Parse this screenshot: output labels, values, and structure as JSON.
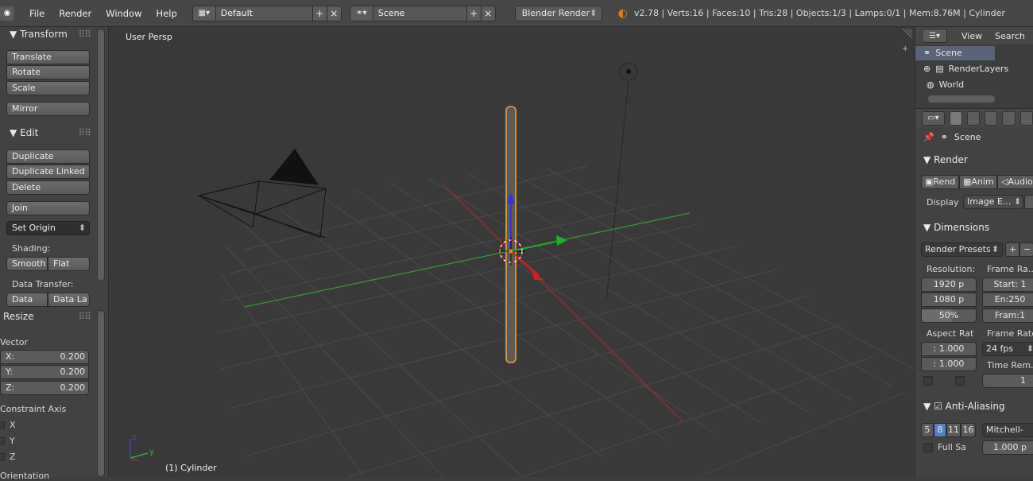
{
  "topbar": {
    "menus": [
      "File",
      "Render",
      "Window",
      "Help"
    ],
    "layout_value": "Default",
    "scene_value": "Scene",
    "renderer": "Blender Render",
    "stats": "v2.78 | Verts:16 | Faces:10 | Tris:28 | Objects:1/3 | Lamps:0/1 | Mem:8.76M | Cylinder"
  },
  "shelf": {
    "transform_title": "Transform",
    "translate": "Translate",
    "rotate": "Rotate",
    "scale": "Scale",
    "mirror": "Mirror",
    "edit_title": "Edit",
    "duplicate": "Duplicate",
    "duplicate_linked": "Duplicate Linked",
    "delete": "Delete",
    "join": "Join",
    "set_origin": "Set Origin",
    "shading_label": "Shading:",
    "smooth": "Smooth",
    "flat": "Flat",
    "data_transfer_label": "Data Transfer:",
    "data": "Data",
    "data_la": "Data La",
    "resize_title": "Resize",
    "vector_label": "Vector",
    "x_label": "X:",
    "x_value": "0.200",
    "y_label": "Y:",
    "y_value": "0.200",
    "z_label": "Z:",
    "z_value": "0.200",
    "constraint_label": "Constraint Axis",
    "cx": "X",
    "cy": "Y",
    "cz": "Z",
    "orientation_label": "Orientation"
  },
  "viewport": {
    "view_label": "User Persp",
    "object_label": "(1) Cylinder",
    "axis_z": "z",
    "axis_y": "y"
  },
  "outliner": {
    "view": "View",
    "search": "Search",
    "rows": [
      "Scene",
      "RenderLayers",
      "World"
    ]
  },
  "properties": {
    "scene_label": "Scene",
    "render_title": "Render",
    "render_btn": "Rend",
    "anim_btn": "Anim",
    "audio_btn": "Audio",
    "display_label": "Display",
    "display_value": "Image E...",
    "dimensions_title": "Dimensions",
    "render_presets": "Render Presets",
    "resolution_label": "Resolution:",
    "res_x": "1920 p",
    "res_y": "1080 p",
    "res_pct": "50%",
    "frame_range_label": "Frame Ra...",
    "start": "Start: 1",
    "end": "En:250",
    "frame": "Fram:1",
    "aspect_label": "Aspect Rat",
    "aspect_x": ": 1.000",
    "aspect_y": ": 1.000",
    "frame_rate_label": "Frame Rate",
    "fps": "24 fps",
    "time_rem_label": "Time Rem...",
    "time_rem_value": "1",
    "aa_title": "Anti-Aliasing",
    "aa_5": "5",
    "aa_8": "8",
    "aa_11": "11",
    "aa_16": "16",
    "filter": "Mitchell-",
    "full_sa": "Full Sa",
    "filter_size": "1.000 p"
  },
  "colors": {
    "accent_orange": "#e87d0d",
    "selected_blue": "#5680c2",
    "grid_x": "#c03030",
    "grid_y": "#30a030"
  }
}
